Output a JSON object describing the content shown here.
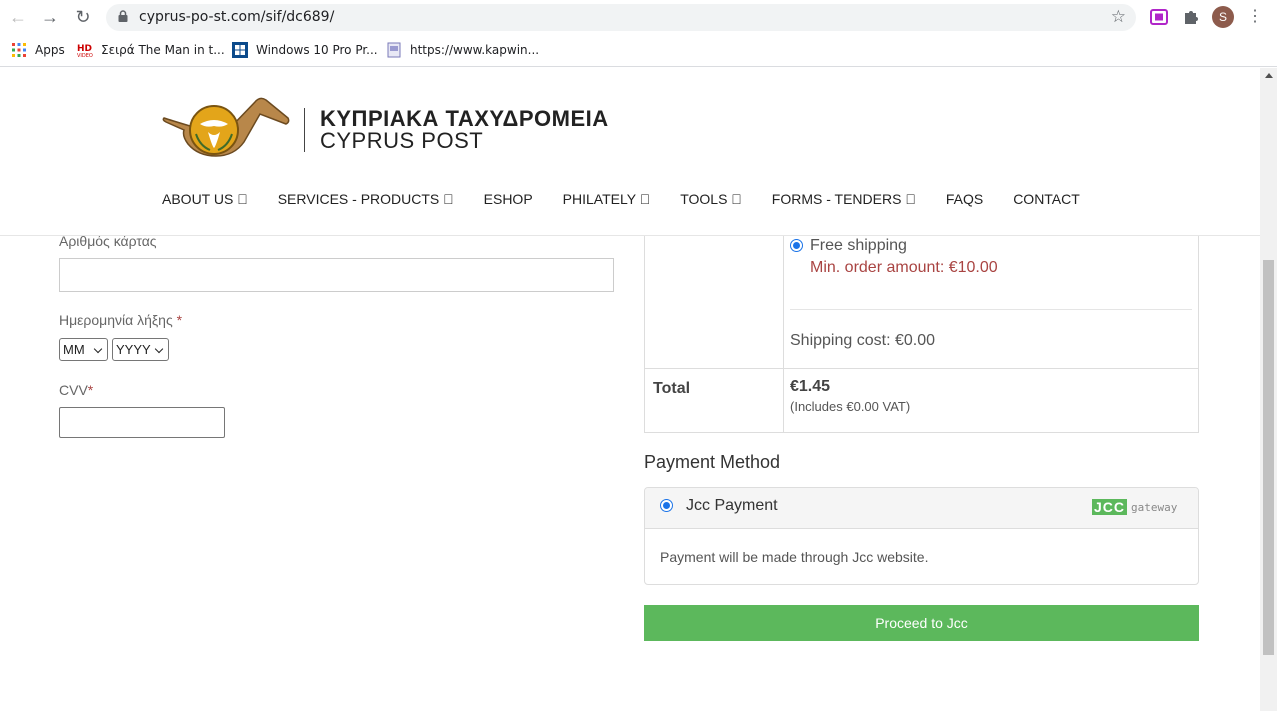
{
  "browser": {
    "url": "cyprus-po-st.com/sif/dc689/",
    "avatar_letter": "S",
    "bookmarks": [
      {
        "label": "Apps",
        "icon": "apps-grid-icon"
      },
      {
        "label": "Σειρά The Man in t...",
        "icon": "hd-video-icon"
      },
      {
        "label": "Windows 10 Pro Pr...",
        "icon": "windows-icon"
      },
      {
        "label": "https://www.kapwin...",
        "icon": "page-icon"
      }
    ]
  },
  "site": {
    "logo_greek": "ΚΥΠΡΙΑΚΑ ΤΑΧΥΔΡΟΜΕΙΑ",
    "logo_english": "CYPRUS POST",
    "menu": [
      {
        "label": "ABOUT US "
      },
      {
        "label": "SERVICES - PRODUCTS "
      },
      {
        "label": "ESHOP"
      },
      {
        "label": "PHILATELY "
      },
      {
        "label": "TOOLS "
      },
      {
        "label": "FORMS - TENDERS "
      },
      {
        "label": "FAQS"
      },
      {
        "label": "CONTACT"
      }
    ]
  },
  "card_form": {
    "card_number_label": "Αριθμός κάρτας",
    "expiry_label": "Ημερομηνία λήξης",
    "expiry_required": "*",
    "month_value": "MM",
    "year_value": "YYYY",
    "cvv_label": "CVV",
    "cvv_required": "*"
  },
  "order_summary": {
    "shipping_option": "Free shipping",
    "shipping_note": "Min. order amount: €10.00",
    "shipping_cost": "Shipping cost: €0.00",
    "total_label": "Total",
    "total_value": "€1.45",
    "vat_note": "(Includes €0.00 VAT)"
  },
  "payment": {
    "heading": "Payment Method",
    "method_label": "Jcc Payment",
    "gateway_brand": "JCC",
    "gateway_word": "gateway",
    "description": "Payment will be made through Jcc website.",
    "button_label": "Proceed to Jcc"
  },
  "colors": {
    "accent_green": "#5cb85c",
    "error_red": "#a94442"
  }
}
